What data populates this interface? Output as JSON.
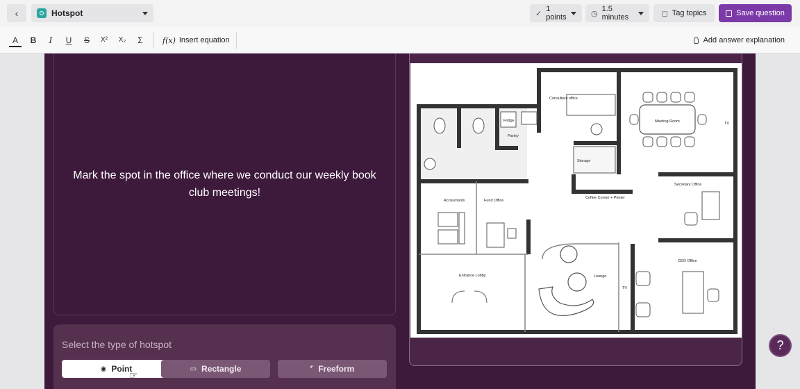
{
  "header": {
    "back_icon": "chevron-left-icon",
    "question_type": "Hotspot",
    "points": "1 points",
    "time": "1.5 minutes",
    "tag_topics": "Tag topics",
    "save": "Save question",
    "accent_color": "#7c3aa8"
  },
  "toolbar": {
    "text_color": "A",
    "bold": "B",
    "italic": "I",
    "underline": "U",
    "strikethrough": "S",
    "superscript": "X²",
    "subscript": "X₂",
    "sigma": "Σ",
    "insert_equation": "Insert equation",
    "add_explanation": "Add answer explanation"
  },
  "question": {
    "text": "Mark the spot in the office where we conduct our weekly book club meetings!"
  },
  "hotspot": {
    "title": "Select the type of hotspot",
    "types": [
      {
        "label": "Point",
        "icon": "point-icon",
        "selected": true
      },
      {
        "label": "Rectangle",
        "icon": "rectangle-icon",
        "selected": false
      },
      {
        "label": "Freeform",
        "icon": "freeform-icon",
        "selected": false
      }
    ]
  },
  "floorplan": {
    "rooms": [
      "Consultant office",
      "Meeting Room",
      "TV",
      "Fridge",
      "Pantry",
      "Storage",
      "Secretary Office",
      "Accountants",
      "Fund Office",
      "Coffee Corner + Printer",
      "Entrance Lobby",
      "Lounge",
      "TV",
      "CEO Office"
    ]
  },
  "help": {
    "label": "?"
  }
}
